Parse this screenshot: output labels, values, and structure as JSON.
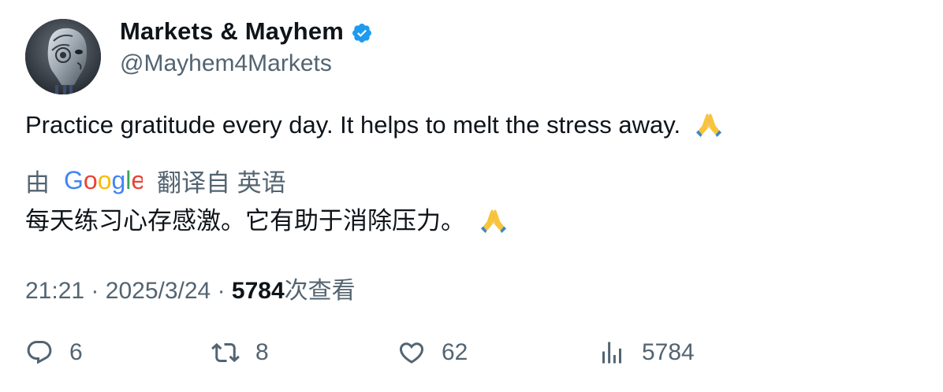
{
  "author": {
    "display_name": "Markets & Mayhem",
    "handle": "@Mayhem4Markets",
    "verified_icon": "verified-badge-icon",
    "avatar_icon": "robot-head-avatar",
    "verified_color": "#1d9bf0"
  },
  "tweet": {
    "text": "Practice gratitude every day. It helps to melt the stress away.",
    "emoji": "folded-hands-emoji"
  },
  "translation": {
    "by_label": "由",
    "provider": "Google",
    "translated_from": "翻译自 英语",
    "text": "每天练习心存感激。它有助于消除压力。"
  },
  "meta": {
    "time": "21:21",
    "date": "2025/3/24",
    "sep": "·",
    "views_count": "5784",
    "views_label": "次查看"
  },
  "actions": {
    "replies": "6",
    "retweets": "8",
    "likes": "62",
    "views": "5784"
  },
  "colors": {
    "text_primary": "#0f1419",
    "text_secondary": "#536471"
  }
}
